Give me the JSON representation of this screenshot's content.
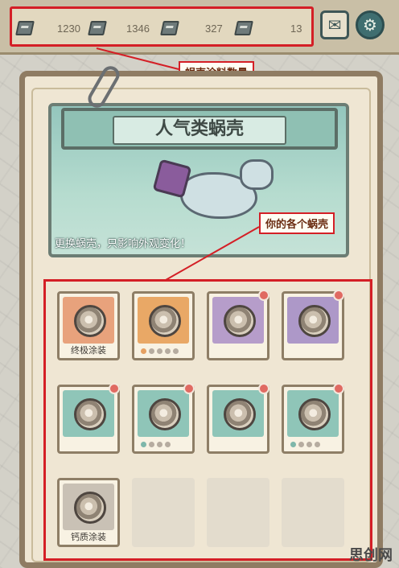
{
  "resources": [
    {
      "icon": "paint-tube-icon",
      "value": "1230"
    },
    {
      "icon": "paint-tube-icon",
      "value": "1346"
    },
    {
      "icon": "paint-tube-icon",
      "value": "327"
    },
    {
      "icon": "paint-tube-icon",
      "value": "13"
    }
  ],
  "top_buttons": {
    "mail": "mail-icon",
    "settings": "gear-icon"
  },
  "annotations": {
    "paint_count": "蜗壳涂料数量",
    "your_shells": "你的各个蜗壳"
  },
  "banner": {
    "title": "人气类蜗壳",
    "note": "更换蜗壳，只影响外观变化！"
  },
  "shells": [
    {
      "label": "终极涂装",
      "art_color": "#e8a27c",
      "badge": false,
      "dots": 0
    },
    {
      "label": "",
      "art_color": "#e9a866",
      "badge": false,
      "dots": 5,
      "dots_on": 1
    },
    {
      "label": "",
      "art_color": "#b69dca",
      "badge": true,
      "dots": 0
    },
    {
      "label": "",
      "art_color": "#ad98c8",
      "badge": true,
      "dots": 0
    },
    {
      "label": "",
      "art_color": "#8fc5b8",
      "badge": true,
      "dots": 0
    },
    {
      "label": "",
      "art_color": "#8fc5b8",
      "badge": true,
      "dots": 4,
      "dots_on": 1
    },
    {
      "label": "",
      "art_color": "#8fc5b8",
      "badge": true,
      "dots": 0
    },
    {
      "label": "",
      "art_color": "#8fc5b8",
      "badge": true,
      "dots": 4,
      "dots_on": 1
    },
    {
      "label": "钙质涂装",
      "art_color": "#c9c1b5",
      "badge": false,
      "dots": 0
    },
    {
      "empty": true
    },
    {
      "empty": true
    },
    {
      "empty": true
    }
  ],
  "watermark": "思创网",
  "colors": {
    "highlight": "#d41f26",
    "panel": "#efe6d3",
    "frame": "#8f7c63"
  }
}
